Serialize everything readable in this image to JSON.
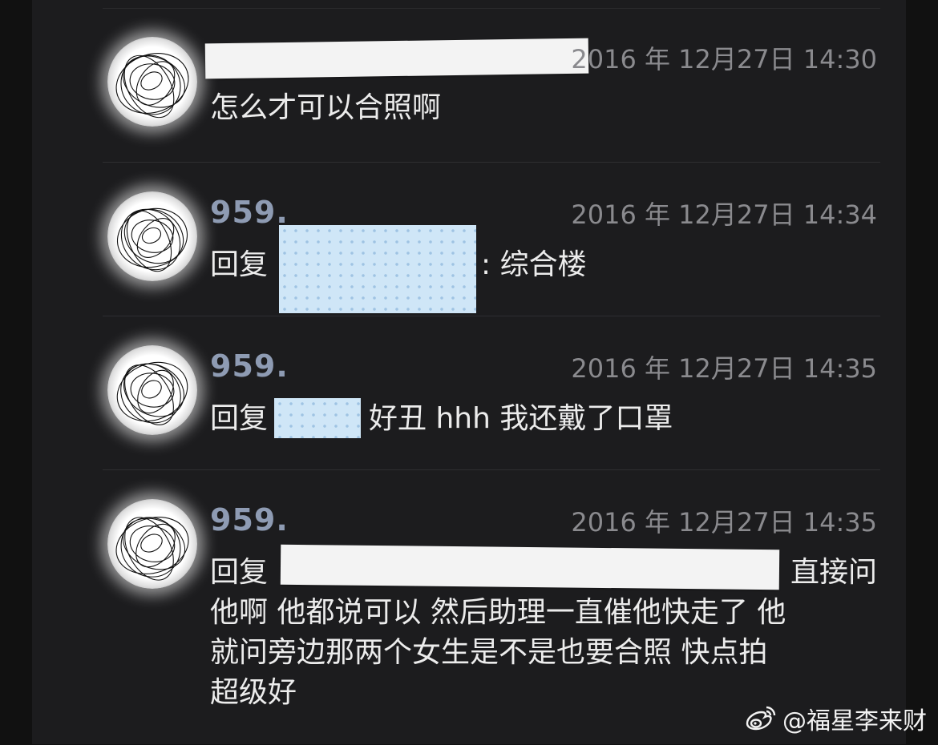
{
  "comments": [
    {
      "username": "",
      "timestamp": "2016 年 12月27日 14:30",
      "text": "怎么才可以合照啊",
      "reply_prefix": "",
      "reply_suffix": ""
    },
    {
      "username": "959.",
      "timestamp": "2016 年 12月27日 14:34",
      "reply_prefix": "回复",
      "reply_suffix": ": 综合楼"
    },
    {
      "username": "959.",
      "timestamp": "2016 年 12月27日 14:35",
      "reply_prefix": "回复",
      "reply_suffix": "好丑 hhh 我还戴了口罩"
    },
    {
      "username": "959.",
      "timestamp": "2016 年 12月27日 14:35",
      "reply_prefix": "回复",
      "reply_suffix": "直接问",
      "lines": [
        "他啊 他都说可以 然后助理一直催他快走了 他",
        "就问旁边那两个女生是不是也要合照 快点拍",
        "超级好"
      ]
    }
  ],
  "watermark": {
    "text": "@福星李来财",
    "icon": "weibo-icon"
  },
  "colors": {
    "background": "#1c1c1e",
    "username": "#8e9bb3",
    "timestamp": "#8a8a8e",
    "text": "#ececec"
  }
}
